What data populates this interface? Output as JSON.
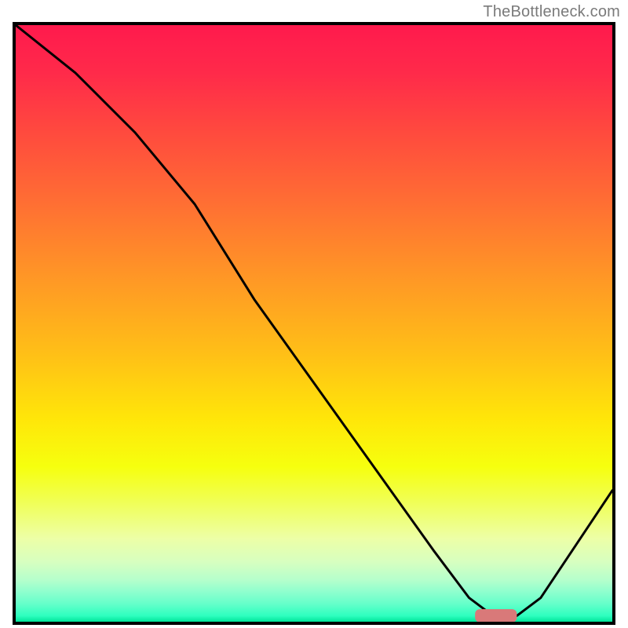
{
  "watermark": "TheBottleneck.com",
  "colors": {
    "border": "#000000",
    "curve": "#000000",
    "marker": "#d97979",
    "watermark_text": "#7a7a7a"
  },
  "chart_data": {
    "type": "line",
    "title": "",
    "xlabel": "",
    "ylabel": "",
    "xlim": [
      0,
      100
    ],
    "ylim": [
      0,
      100
    ],
    "x": [
      0,
      10,
      20,
      30,
      40,
      50,
      60,
      70,
      76,
      80,
      84,
      88,
      100
    ],
    "values": [
      100,
      92,
      82,
      70,
      54,
      40,
      26,
      12,
      4,
      1,
      1,
      4,
      22
    ],
    "optimum_marker": {
      "x_start": 77,
      "x_end": 84,
      "y": 1,
      "thickness": 2.2
    }
  }
}
